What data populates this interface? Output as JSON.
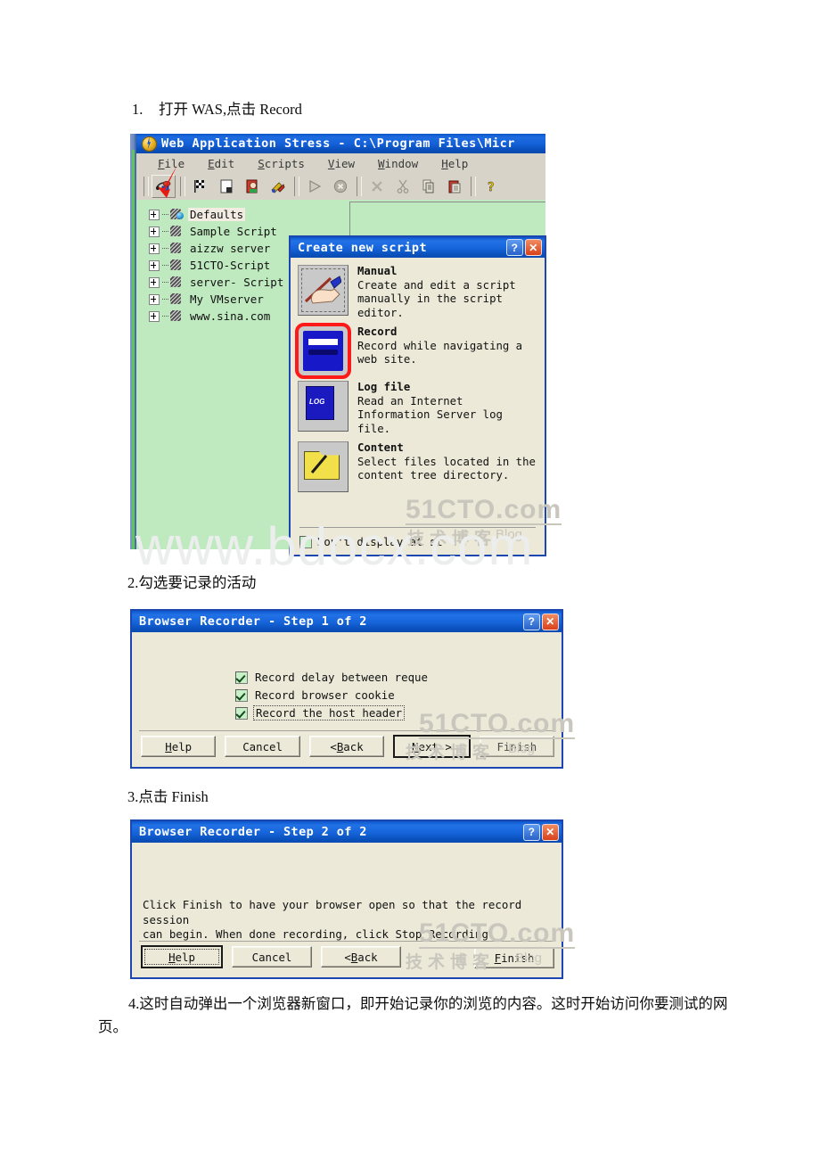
{
  "document": {
    "steps": [
      {
        "num": "1.",
        "text": "打开 WAS,点击 Record"
      },
      {
        "num": "2.",
        "text": "2.勾选要记录的活动"
      },
      {
        "num": "3.",
        "text": "3.点击 Finish"
      },
      {
        "num": "4.",
        "text": "4.这时自动弹出一个浏览器新窗口，即开始记录你的浏览的内容。这时开始访问你要测试的网页。"
      }
    ]
  },
  "watermarks": {
    "site": "www.bdocx.com",
    "cto_main": "51CTO.com",
    "cto_sub": "技术博客",
    "cto_blog": "Blog"
  },
  "was_window": {
    "title": "Web Application Stress - C:\\Program Files\\Micr",
    "menu": [
      {
        "pre": "F",
        "rest": "ile"
      },
      {
        "pre": "E",
        "rest": "dit"
      },
      {
        "pre": "S",
        "rest": "cripts"
      },
      {
        "pre": "V",
        "rest": "iew"
      },
      {
        "pre": "W",
        "rest": "indow"
      },
      {
        "pre": "H",
        "rest": "elp"
      }
    ],
    "toolbar": [
      {
        "name": "new-record-script",
        "glyph": "record"
      },
      {
        "name": "finish-flag",
        "glyph": "flag"
      },
      {
        "name": "save-script",
        "glyph": "save"
      },
      {
        "name": "report-view",
        "glyph": "report"
      },
      {
        "name": "settings-tools",
        "glyph": "tools"
      },
      {
        "name": "run-test",
        "glyph": "play"
      },
      {
        "name": "stop-test",
        "glyph": "stop"
      },
      {
        "name": "delete-item",
        "glyph": "delete"
      },
      {
        "name": "cut",
        "glyph": "cut"
      },
      {
        "name": "copy",
        "glyph": "copy"
      },
      {
        "name": "paste",
        "glyph": "paste"
      },
      {
        "name": "help",
        "glyph": "question"
      }
    ],
    "tree_items": [
      "Defaults",
      "Sample Script",
      "aizzw server",
      "51CTO-Script",
      "server- Script",
      "My VMserver",
      "www.sina.com"
    ],
    "selected_tree_item": "Defaults"
  },
  "create_new_script": {
    "title": "Create new script",
    "help_button": "?",
    "close_button": "✕",
    "options": [
      {
        "icon": "hand-pencil-icon",
        "title": "Manual",
        "desc": "Create and edit a script manually in the script editor.",
        "highlighted": false
      },
      {
        "icon": "cassette-tape-icon",
        "title": "Record",
        "desc": "Record while navigating a web site.",
        "highlighted": true
      },
      {
        "icon": "log-book-icon",
        "title": "Log file",
        "desc": "Read an Internet Information Server log file.",
        "highlighted": false
      },
      {
        "icon": "folder-icon",
        "title": "Content",
        "desc": "Select files located in the content tree directory.",
        "highlighted": false
      }
    ],
    "dont_display_label": "Don't display at st",
    "dont_display_checked": false
  },
  "browser_recorder_step1": {
    "title": "Browser Recorder - Step 1 of 2",
    "help_button": "?",
    "close_button": "✕",
    "checkboxes": [
      {
        "label": "Record delay between reque",
        "checked": true,
        "focused": false
      },
      {
        "label": "Record browser cookie",
        "checked": true,
        "focused": false
      },
      {
        "label": "Record the host header",
        "checked": true,
        "focused": true
      }
    ],
    "buttons": {
      "help": {
        "pre": "H",
        "mid": "elp",
        "accel": "H"
      },
      "cancel": "Cancel",
      "back": "< Back",
      "next": "Next >",
      "finish": "Finish"
    }
  },
  "browser_recorder_step2": {
    "title": "Browser Recorder - Step 2 of 2",
    "help_button": "?",
    "close_button": "✕",
    "body_line1": "Click Finish to have your browser open so that the record session",
    "body_line2": "can begin. When done recording, click Stop Recording.",
    "buttons": {
      "help": "Help",
      "cancel": "Cancel",
      "back": "< Back",
      "finish": "Finish"
    }
  },
  "colors": {
    "titlebar_blue": "#1664da",
    "dialog_face": "#ece9d8",
    "tree_green": "#bfe9bf",
    "highlight_red": "#ff1a1a",
    "watermark_grey": "#c9c7bd"
  }
}
